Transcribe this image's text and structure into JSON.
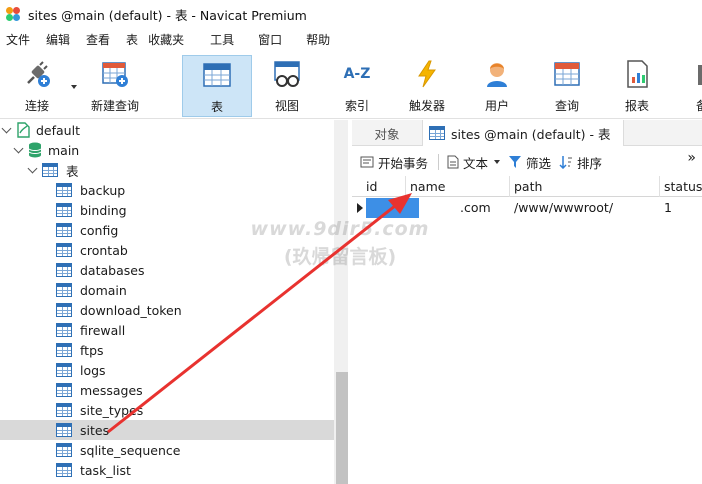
{
  "window": {
    "title": "sites @main (default) - 表 - Navicat Premium"
  },
  "menu": [
    "文件",
    "编辑",
    "查看",
    "表",
    "收藏夹",
    "工具",
    "窗口",
    "帮助"
  ],
  "toolbar": {
    "items": [
      {
        "label": "连接",
        "icon": "plug-icon"
      },
      {
        "label": "新建查询",
        "icon": "new-query-icon"
      },
      {
        "label": "表",
        "icon": "table-icon",
        "active": true
      },
      {
        "label": "视图",
        "icon": "view-icon"
      },
      {
        "label": "索引",
        "icon": "index-icon",
        "glyph": "A-Z"
      },
      {
        "label": "触发器",
        "icon": "lightning-icon"
      },
      {
        "label": "用户",
        "icon": "user-icon"
      },
      {
        "label": "查询",
        "icon": "query-icon"
      },
      {
        "label": "报表",
        "icon": "report-icon"
      },
      {
        "label": "备",
        "icon": "backup-icon"
      }
    ]
  },
  "tree": {
    "connection": "default",
    "database": "main",
    "group": "表",
    "tables": [
      "backup",
      "binding",
      "config",
      "crontab",
      "databases",
      "domain",
      "download_token",
      "firewall",
      "ftps",
      "logs",
      "messages",
      "site_types",
      "sites",
      "sqlite_sequence",
      "task_list"
    ],
    "selected": "sites"
  },
  "tabs": {
    "objects": "对象",
    "active": "sites @main (default) - 表"
  },
  "subtoolbar": {
    "begin_transaction": "开始事务",
    "text": "文本",
    "filter": "筛选",
    "sort": "排序",
    "more": "»"
  },
  "grid": {
    "columns": [
      "id",
      "name",
      "path",
      "status"
    ],
    "rows": [
      {
        "id": "",
        "name": ".com",
        "path": "/www/wwwroot/",
        "status": "1"
      }
    ]
  },
  "watermark": {
    "line1": "www.9dir5.com",
    "line2": "(玖帰留言板)"
  },
  "colors": {
    "selection": "#3d8fe6",
    "arrow": "#e8322f",
    "active_tool": "#cde5f7"
  }
}
